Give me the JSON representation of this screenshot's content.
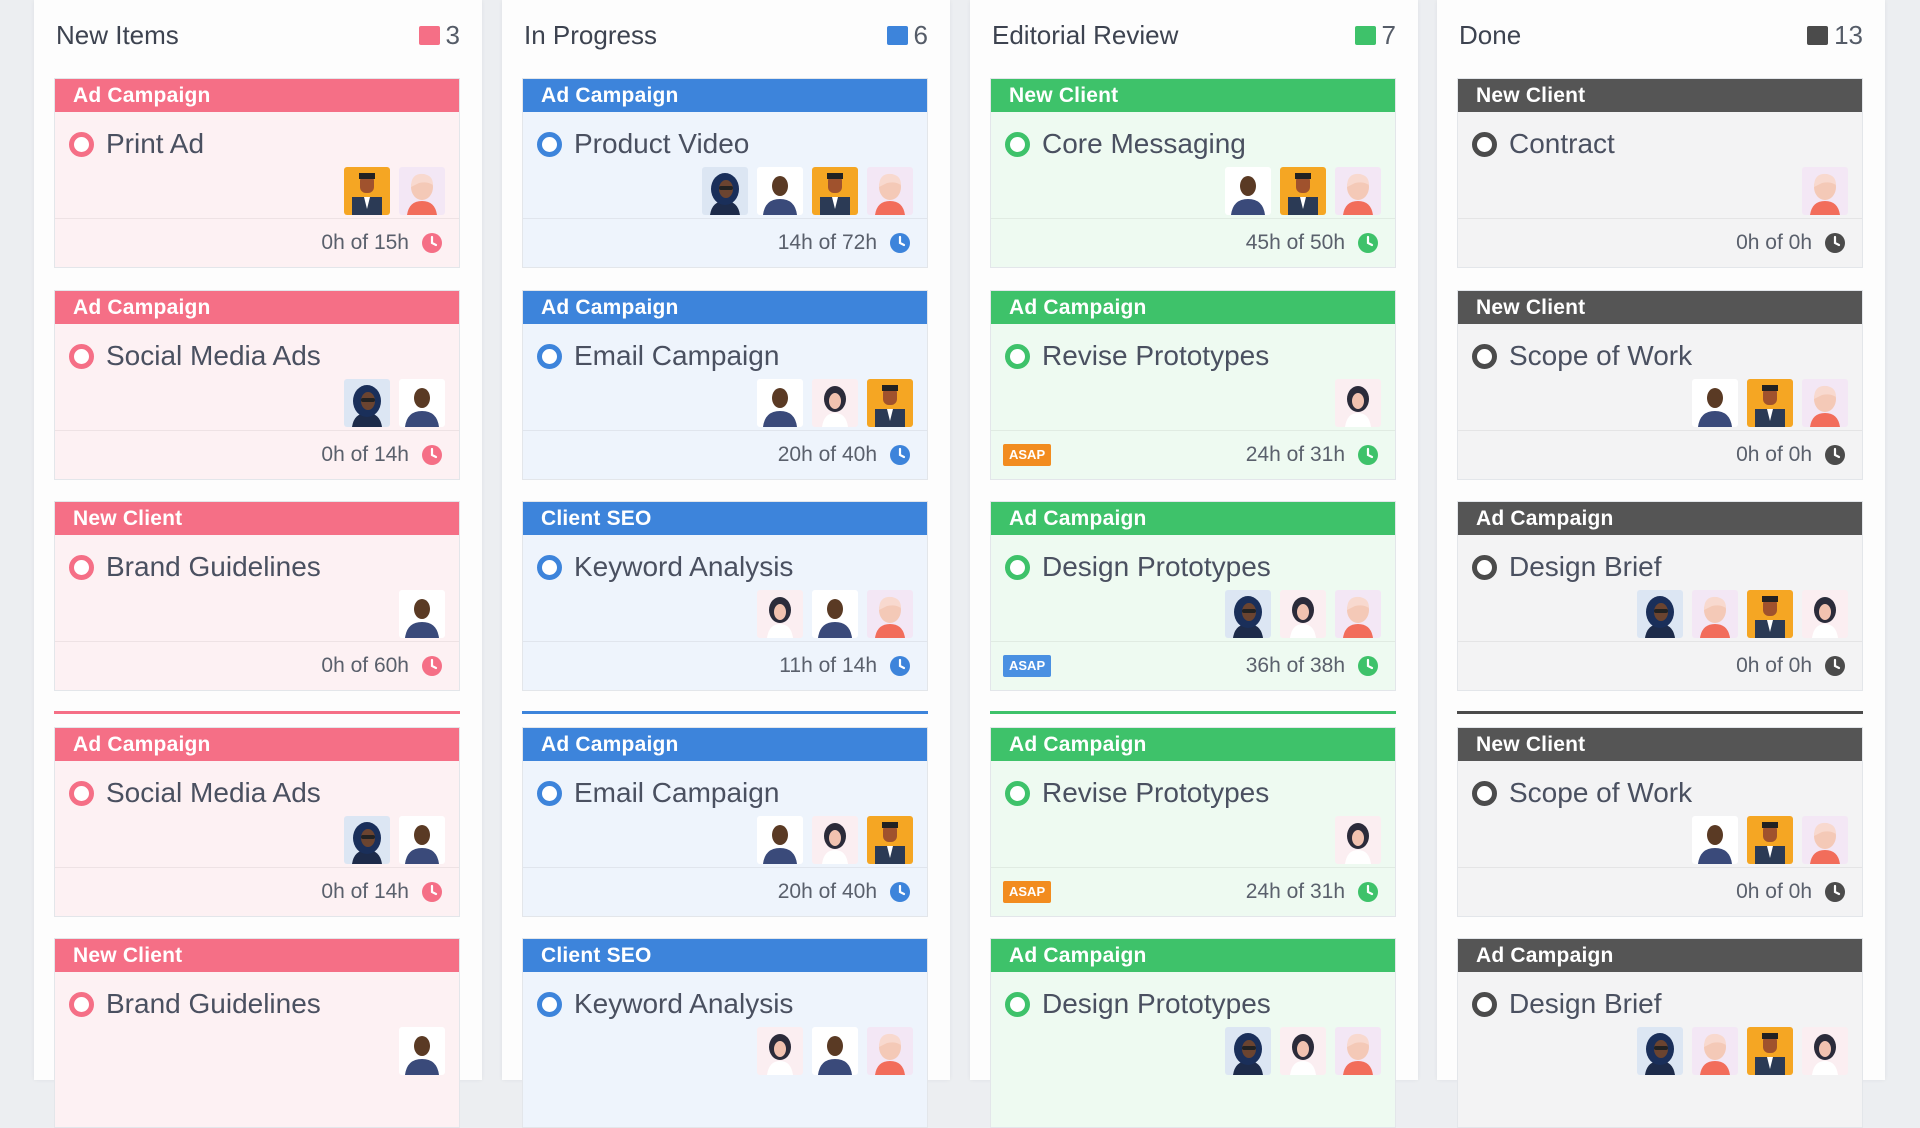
{
  "columns": [
    {
      "title": "New Items",
      "count": "3",
      "color": "#f56f86",
      "cards": [
        {
          "tag": "Ad Campaign",
          "title": "Print Ad",
          "hours": "0h of 15h",
          "avatars": [
            "man-yellow",
            "woman-red"
          ]
        },
        {
          "tag": "Ad Campaign",
          "title": "Social Media Ads",
          "hours": "0h of 14h",
          "avatars": [
            "woman-dark",
            "man-dark"
          ]
        },
        {
          "tag": "New Client",
          "title": "Brand Guidelines",
          "hours": "0h of 60h",
          "avatars": [
            "man-dark"
          ]
        },
        {
          "tag": "Ad Campaign",
          "title": "Social Media Ads",
          "hours": "0h of 14h",
          "avatars": [
            "woman-dark",
            "man-dark"
          ]
        },
        {
          "tag": "New Client",
          "title": "Brand Guidelines",
          "hours": "",
          "avatars": [
            "man-dark"
          ]
        }
      ]
    },
    {
      "title": "In Progress",
      "count": "6",
      "color": "#3d84db",
      "cards": [
        {
          "tag": "Ad Campaign",
          "title": "Product Video",
          "hours": "14h of 72h",
          "avatars": [
            "woman-dark",
            "man-dark",
            "man-yellow",
            "woman-red"
          ]
        },
        {
          "tag": "Ad Campaign",
          "title": "Email Campaign",
          "hours": "20h of 40h",
          "avatars": [
            "man-dark",
            "woman-pink",
            "man-yellow"
          ]
        },
        {
          "tag": "Client SEO",
          "title": "Keyword Analysis",
          "hours": "11h of 14h",
          "avatars": [
            "woman-pink",
            "man-dark",
            "woman-red"
          ]
        },
        {
          "tag": "Ad Campaign",
          "title": "Email Campaign",
          "hours": "20h of 40h",
          "avatars": [
            "man-dark",
            "woman-pink",
            "man-yellow"
          ]
        },
        {
          "tag": "Client SEO",
          "title": "Keyword Analysis",
          "hours": "",
          "avatars": [
            "woman-pink",
            "man-dark",
            "woman-red"
          ]
        }
      ]
    },
    {
      "title": "Editorial Review",
      "count": "7",
      "color": "#3ec26a",
      "cards": [
        {
          "tag": "New Client",
          "title": "Core Messaging",
          "hours": "45h of 50h",
          "avatars": [
            "man-dark",
            "man-yellow",
            "woman-red"
          ]
        },
        {
          "tag": "Ad Campaign",
          "title": "Revise Prototypes",
          "hours": "24h of 31h",
          "avatars": [
            "woman-pink"
          ],
          "asap": "ASAP",
          "asap_color": "#f28c1f"
        },
        {
          "tag": "Ad Campaign",
          "title": "Design Prototypes",
          "hours": "36h of 38h",
          "avatars": [
            "woman-dark",
            "woman-pink",
            "woman-red"
          ],
          "asap": "ASAP",
          "asap_color": "#4a90e2"
        },
        {
          "tag": "Ad Campaign",
          "title": "Revise Prototypes",
          "hours": "24h of 31h",
          "avatars": [
            "woman-pink"
          ],
          "asap": "ASAP",
          "asap_color": "#f28c1f"
        },
        {
          "tag": "Ad Campaign",
          "title": "Design Prototypes",
          "hours": "",
          "avatars": [
            "woman-dark",
            "woman-pink",
            "woman-red"
          ]
        }
      ]
    },
    {
      "title": "Done",
      "count": "13",
      "color": "#4b4b4b",
      "cards": [
        {
          "tag": "New Client",
          "title": "Contract",
          "hours": "0h of 0h",
          "avatars": [
            "woman-red"
          ]
        },
        {
          "tag": "New Client",
          "title": "Scope of Work",
          "hours": "0h of 0h",
          "avatars": [
            "man-dark",
            "man-yellow",
            "woman-red"
          ]
        },
        {
          "tag": "Ad Campaign",
          "title": "Design Brief",
          "hours": "0h of 0h",
          "avatars": [
            "woman-dark",
            "woman-red",
            "man-yellow",
            "woman-pink"
          ]
        },
        {
          "tag": "New Client",
          "title": "Scope of Work",
          "hours": "0h of 0h",
          "avatars": [
            "man-dark",
            "man-yellow",
            "woman-red"
          ]
        },
        {
          "tag": "Ad Campaign",
          "title": "Design Brief",
          "hours": "",
          "avatars": [
            "woman-dark",
            "woman-red",
            "man-yellow",
            "woman-pink"
          ]
        }
      ]
    }
  ]
}
